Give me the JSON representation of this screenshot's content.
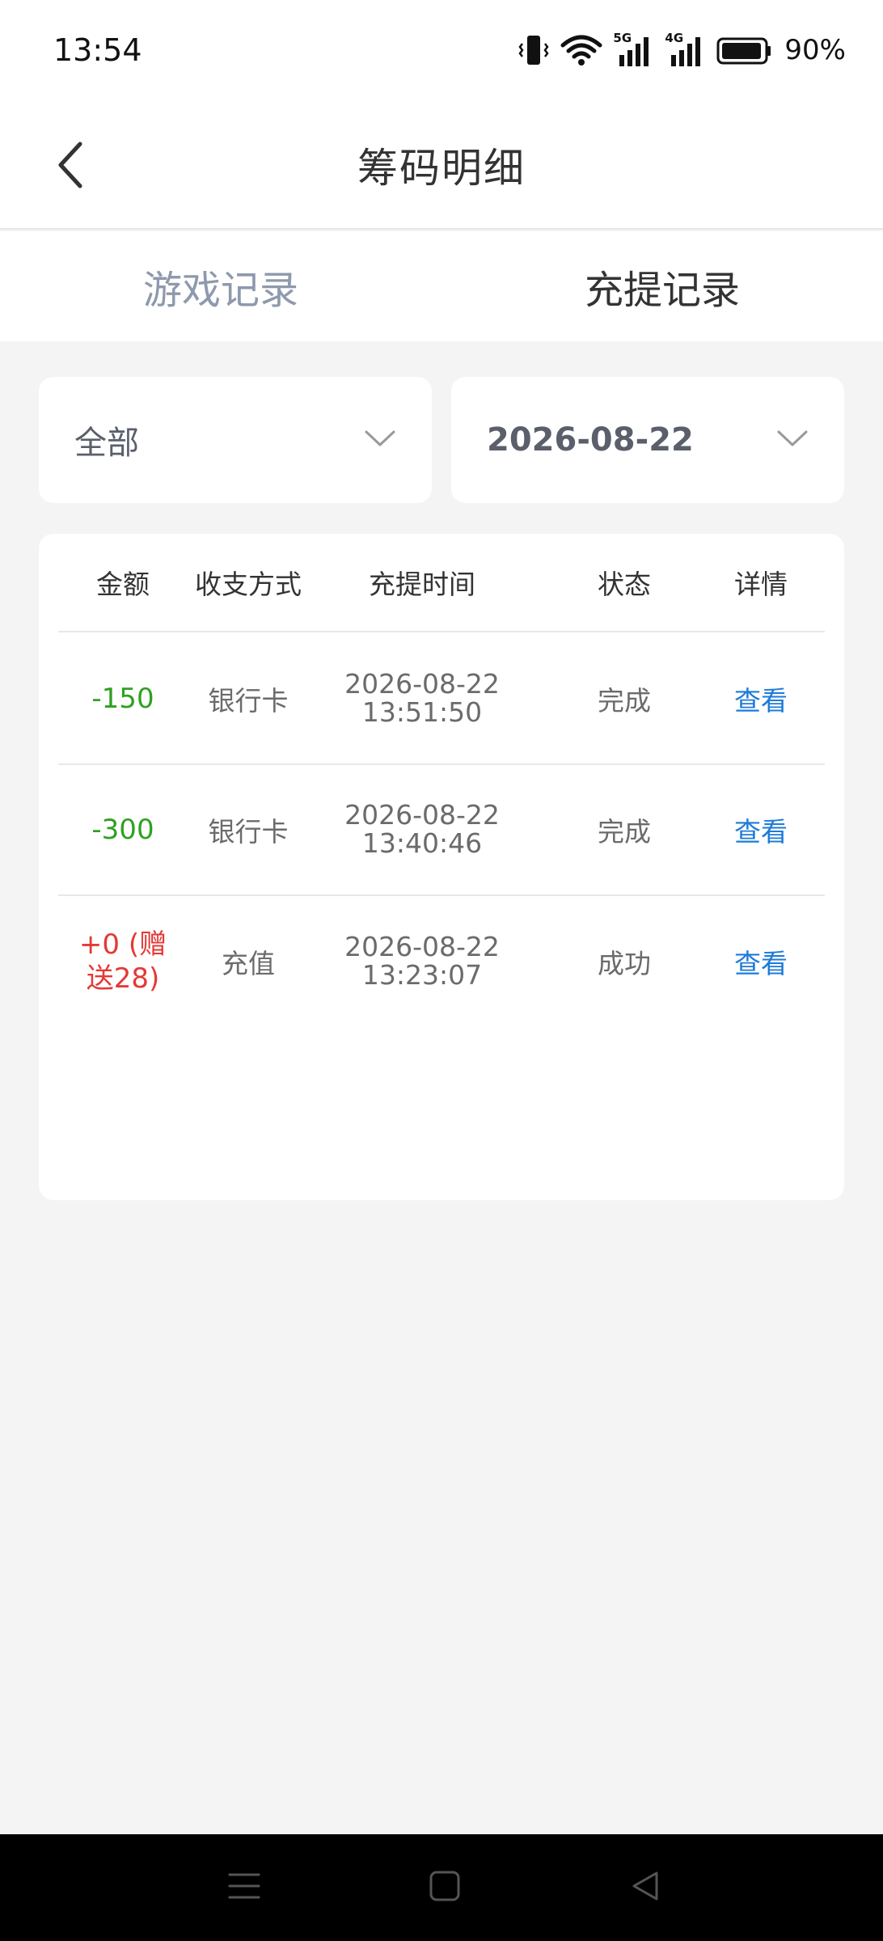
{
  "status_bar": {
    "time": "13:54",
    "network_5g": "5G",
    "network_4g": "4G",
    "battery": "90%"
  },
  "header": {
    "title": "筹码明细",
    "back_icon": "chevron-left-icon"
  },
  "tabs": [
    {
      "label": "游戏记录",
      "active": false
    },
    {
      "label": "充提记录",
      "active": true
    }
  ],
  "filters": {
    "type": "全部",
    "date": "2026-08-22"
  },
  "table": {
    "columns": [
      "金额",
      "收支方式",
      "充提时间",
      "状态",
      "详情"
    ],
    "rows": [
      {
        "amount": "-150",
        "method": "银行卡",
        "date": "2026-08-22",
        "time": "13:51:50",
        "status": "完成",
        "detail": "查看"
      },
      {
        "amount": "-300",
        "method": "银行卡",
        "date": "2026-08-22",
        "time": "13:40:46",
        "status": "完成",
        "detail": "查看"
      },
      {
        "amount": "+0 (赠送28)",
        "method": "充值",
        "date": "2026-08-22",
        "time": "13:23:07",
        "status": "成功",
        "detail": "查看"
      }
    ]
  },
  "colors": {
    "negative_amount": "#2ea121",
    "positive_amount": "#e53935",
    "link": "#1e7bd8",
    "inactive_tab": "#8e99ad"
  }
}
